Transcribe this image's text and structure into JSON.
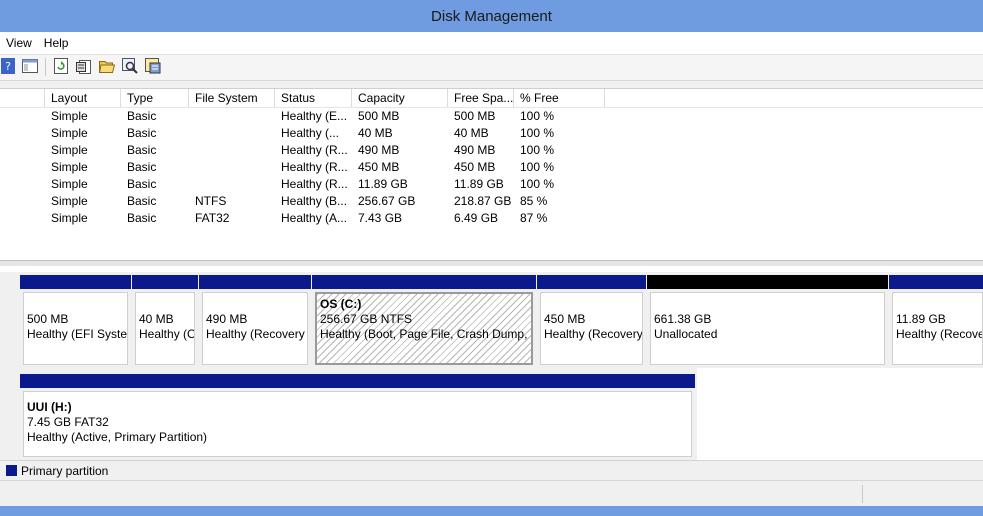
{
  "window": {
    "title": "Disk Management"
  },
  "menu": [
    {
      "label": "View"
    },
    {
      "label": "Help"
    }
  ],
  "toolbar": {
    "buttons": [
      {
        "icon": "help-icon"
      },
      {
        "icon": "console-tree-icon"
      },
      {
        "icon": "refresh-icon"
      },
      {
        "icon": "properties-icon"
      },
      {
        "icon": "open-folder-icon"
      },
      {
        "icon": "explore-icon"
      },
      {
        "icon": "settings-icon"
      }
    ]
  },
  "volume_list": {
    "columns": [
      {
        "label": "Layout"
      },
      {
        "label": "Type"
      },
      {
        "label": "File System"
      },
      {
        "label": "Status"
      },
      {
        "label": "Capacity"
      },
      {
        "label": "Free Spa..."
      },
      {
        "label": "% Free"
      }
    ],
    "rows": [
      {
        "layout": "Simple",
        "type": "Basic",
        "fs": "",
        "status": "Healthy (E...",
        "capacity": "500 MB",
        "free": "500 MB",
        "pct": "100 %"
      },
      {
        "layout": "Simple",
        "type": "Basic",
        "fs": "",
        "status": "Healthy (...",
        "capacity": "40 MB",
        "free": "40 MB",
        "pct": "100 %"
      },
      {
        "layout": "Simple",
        "type": "Basic",
        "fs": "",
        "status": "Healthy (R...",
        "capacity": "490 MB",
        "free": "490 MB",
        "pct": "100 %"
      },
      {
        "layout": "Simple",
        "type": "Basic",
        "fs": "",
        "status": "Healthy (R...",
        "capacity": "450 MB",
        "free": "450 MB",
        "pct": "100 %"
      },
      {
        "layout": "Simple",
        "type": "Basic",
        "fs": "",
        "status": "Healthy (R...",
        "capacity": "11.89 GB",
        "free": "11.89 GB",
        "pct": "100 %"
      },
      {
        "layout": "Simple",
        "type": "Basic",
        "fs": "NTFS",
        "status": "Healthy (B...",
        "capacity": "256.67 GB",
        "free": "218.87 GB",
        "pct": "85 %"
      },
      {
        "layout": "Simple",
        "type": "Basic",
        "fs": "FAT32",
        "status": "Healthy (A...",
        "capacity": "7.43 GB",
        "free": "6.49 GB",
        "pct": "87 %"
      }
    ]
  },
  "disk0": {
    "partitions": [
      {
        "title": "",
        "size": "500 MB",
        "status": "Healthy (EFI System Partition)"
      },
      {
        "title": "",
        "size": "40 MB",
        "status": "Healthy (OEM Partition)"
      },
      {
        "title": "",
        "size": "490 MB",
        "status": "Healthy (Recovery Partition)"
      },
      {
        "title": "OS  (C:)",
        "size": "256.67 GB NTFS",
        "status": "Healthy (Boot, Page File, Crash Dump, Primary Partition)"
      },
      {
        "title": "",
        "size": "450 MB",
        "status": "Healthy (Recovery Partition)"
      },
      {
        "title": "",
        "size": "661.38 GB",
        "status": "Unallocated"
      },
      {
        "title": "",
        "size": "11.89 GB",
        "status": "Healthy (Recovery Partition)"
      }
    ]
  },
  "disk1": {
    "partitions": [
      {
        "title": "UUI  (H:)",
        "size": "7.45 GB FAT32",
        "status": "Healthy (Active, Primary Partition)"
      }
    ]
  },
  "legend": {
    "primary_partition": "Primary partition",
    "color": "#0a1a8a"
  },
  "colors": {
    "title_bar": "#6f9be0",
    "partition_bar": "#0a1a8a",
    "unallocated_bar": "#000000"
  }
}
